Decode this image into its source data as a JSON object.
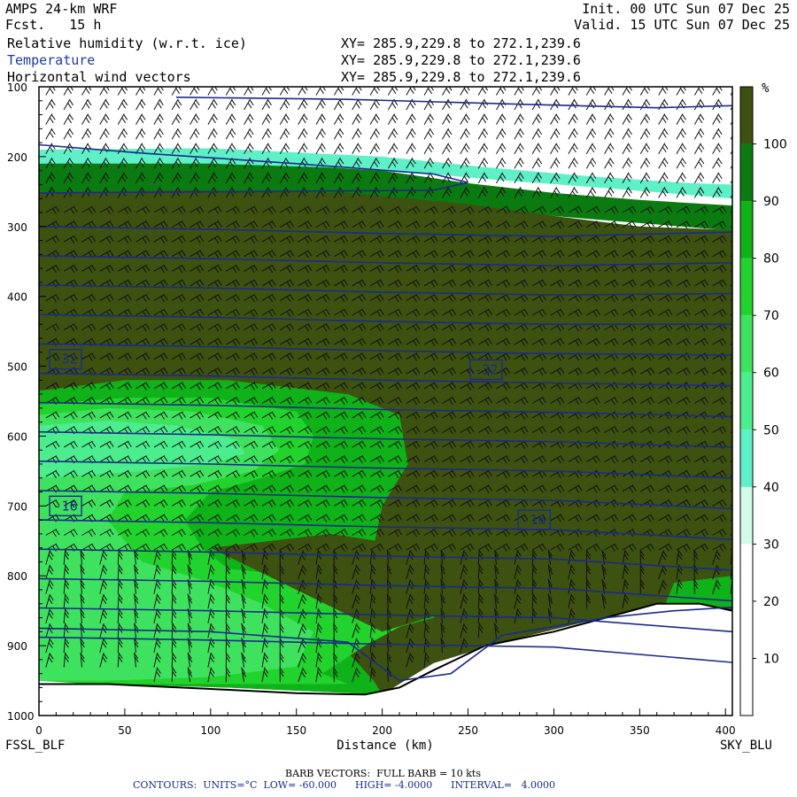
{
  "header": {
    "model": "AMPS 24-km WRF",
    "forecast": "Fcst.   15 h",
    "init": "Init. 00 UTC Sun 07 Dec 25",
    "valid": "Valid. 15 UTC Sun 07 Dec 25",
    "fields": [
      {
        "label": "Relative humidity (w.r.t. ice)",
        "xy": "XY= 285.9,229.8 to 272.1,239.6",
        "color": "#000000"
      },
      {
        "label": "Temperature",
        "xy": "XY= 285.9,229.8 to 272.1,239.6",
        "color": "#1f3aa0"
      },
      {
        "label": "Horizontal wind vectors",
        "xy": "XY= 285.9,229.8 to 272.1,239.6",
        "color": "#000000"
      }
    ]
  },
  "chart_data": {
    "type": "heatmap",
    "xlabel": "Distance (km)",
    "xlim": [
      0,
      404
    ],
    "x_ticks": [
      0,
      50,
      100,
      150,
      200,
      250,
      300,
      350,
      400
    ],
    "ylim": [
      1000,
      100
    ],
    "y_ticks": [
      100,
      200,
      300,
      400,
      500,
      600,
      700,
      800,
      900,
      1000
    ],
    "left_endpoint": "FSSL_BLF",
    "right_endpoint": "SKY_BLU",
    "colorbar": {
      "unit": "%",
      "labels": [
        10,
        20,
        30,
        40,
        50,
        60,
        70,
        80,
        90,
        100
      ],
      "bins": [
        {
          "from": 0,
          "to": 10,
          "color": "#ffffff"
        },
        {
          "from": 10,
          "to": 20,
          "color": "#ffffff"
        },
        {
          "from": 20,
          "to": 30,
          "color": "#ffffff"
        },
        {
          "from": 30,
          "to": 40,
          "color": "#d2fbea"
        },
        {
          "from": 40,
          "to": 50,
          "color": "#5ff0c8"
        },
        {
          "from": 50,
          "to": 60,
          "color": "#4ced8e"
        },
        {
          "from": 60,
          "to": 70,
          "color": "#3fe25e"
        },
        {
          "from": 70,
          "to": 80,
          "color": "#22d32d"
        },
        {
          "from": 80,
          "to": 90,
          "color": "#0fb218"
        },
        {
          "from": 90,
          "to": 100,
          "color": "#0b7a10"
        },
        {
          "from": 100,
          "to": 110,
          "color": "#3d5110"
        }
      ]
    },
    "rh_regions": [
      {
        "rh": 100,
        "points": [
          [
            0,
            250
          ],
          [
            80,
            245
          ],
          [
            180,
            250
          ],
          [
            250,
            265
          ],
          [
            300,
            285
          ],
          [
            350,
            300
          ],
          [
            404,
            305
          ],
          [
            404,
            850
          ],
          [
            365,
            850
          ],
          [
            320,
            865
          ],
          [
            270,
            895
          ],
          [
            230,
            925
          ],
          [
            200,
            970
          ],
          [
            110,
            960
          ],
          [
            40,
            955
          ],
          [
            0,
            950
          ]
        ]
      },
      {
        "rh": 90,
        "points": [
          [
            0,
            210
          ],
          [
            100,
            205
          ],
          [
            200,
            220
          ],
          [
            250,
            238
          ],
          [
            300,
            252
          ],
          [
            350,
            262
          ],
          [
            404,
            270
          ],
          [
            404,
            306
          ],
          [
            300,
            285
          ],
          [
            250,
            268
          ],
          [
            180,
            252
          ],
          [
            80,
            248
          ],
          [
            0,
            252
          ]
        ]
      },
      {
        "rh": 40,
        "points": [
          [
            0,
            190
          ],
          [
            100,
            188
          ],
          [
            200,
            200
          ],
          [
            260,
            215
          ],
          [
            320,
            228
          ],
          [
            380,
            238
          ],
          [
            404,
            240
          ],
          [
            404,
            260
          ],
          [
            330,
            245
          ],
          [
            260,
            232
          ],
          [
            200,
            218
          ],
          [
            100,
            210
          ],
          [
            0,
            210
          ]
        ]
      },
      {
        "rh": 80,
        "points": [
          [
            0,
            535
          ],
          [
            50,
            520
          ],
          [
            110,
            520
          ],
          [
            180,
            540
          ],
          [
            210,
            570
          ],
          [
            215,
            640
          ],
          [
            200,
            700
          ],
          [
            195,
            760
          ],
          [
            220,
            800
          ],
          [
            240,
            820
          ],
          [
            230,
            860
          ],
          [
            200,
            880
          ],
          [
            180,
            910
          ],
          [
            195,
            950
          ],
          [
            200,
            970
          ],
          [
            110,
            960
          ],
          [
            40,
            955
          ],
          [
            0,
            950
          ]
        ]
      },
      {
        "rh": 80,
        "points": [
          [
            404,
            800
          ],
          [
            370,
            810
          ],
          [
            365,
            840
          ],
          [
            404,
            845
          ]
        ]
      },
      {
        "rh": 70,
        "points": [
          [
            0,
            555
          ],
          [
            50,
            545
          ],
          [
            100,
            545
          ],
          [
            150,
            565
          ],
          [
            160,
            600
          ],
          [
            155,
            640
          ],
          [
            130,
            660
          ],
          [
            100,
            680
          ],
          [
            85,
            720
          ],
          [
            95,
            760
          ],
          [
            110,
            790
          ],
          [
            170,
            805
          ],
          [
            220,
            860
          ],
          [
            190,
            900
          ],
          [
            165,
            940
          ],
          [
            180,
            955
          ],
          [
            100,
            955
          ],
          [
            30,
            955
          ],
          [
            0,
            950
          ]
        ]
      },
      {
        "rh": 60,
        "points": [
          [
            0,
            570
          ],
          [
            40,
            560
          ],
          [
            90,
            565
          ],
          [
            130,
            585
          ],
          [
            140,
            620
          ],
          [
            125,
            650
          ],
          [
            90,
            670
          ],
          [
            50,
            680
          ],
          [
            40,
            720
          ],
          [
            60,
            780
          ],
          [
            100,
            810
          ],
          [
            130,
            840
          ],
          [
            160,
            880
          ],
          [
            150,
            930
          ],
          [
            100,
            945
          ],
          [
            40,
            950
          ],
          [
            0,
            950
          ]
        ]
      },
      {
        "rh": 50,
        "points": [
          [
            0,
            585
          ],
          [
            40,
            578
          ],
          [
            80,
            585
          ],
          [
            115,
            605
          ],
          [
            120,
            625
          ],
          [
            100,
            640
          ],
          [
            60,
            650
          ],
          [
            30,
            655
          ],
          [
            0,
            660
          ]
        ]
      },
      {
        "rh": 100,
        "points": [
          [
            100,
            760
          ],
          [
            170,
            740
          ],
          [
            250,
            770
          ],
          [
            300,
            810
          ],
          [
            240,
            850
          ],
          [
            200,
            880
          ],
          [
            150,
            820
          ]
        ]
      }
    ],
    "temperature_contours_C": {
      "units": "°C",
      "low": -60,
      "high": -4,
      "interval": 4,
      "labels": [
        {
          "value": -32,
          "x": 15,
          "pressure": 490
        },
        {
          "value": -32,
          "x": 260,
          "pressure": 505
        },
        {
          "value": -16,
          "x": 15,
          "pressure": 700
        },
        {
          "value": -16,
          "x": 288,
          "pressure": 720
        }
      ]
    },
    "wind": {
      "units": "kts",
      "full_barb_kts": 10
    },
    "terrain_surface": [
      [
        0,
        955
      ],
      [
        40,
        955
      ],
      [
        100,
        962
      ],
      [
        150,
        968
      ],
      [
        190,
        970
      ],
      [
        210,
        960
      ],
      [
        230,
        935
      ],
      [
        260,
        900
      ],
      [
        300,
        880
      ],
      [
        330,
        860
      ],
      [
        360,
        840
      ],
      [
        385,
        840
      ],
      [
        404,
        850
      ]
    ]
  },
  "footer": {
    "barb_note": "BARB VECTORS:  FULL BARB = 10 kts",
    "contours_note": "CONTOURS:  UNITS=°C  LOW= -60.000      HIGH= -4.0000      INTERVAL=   4.0000"
  }
}
